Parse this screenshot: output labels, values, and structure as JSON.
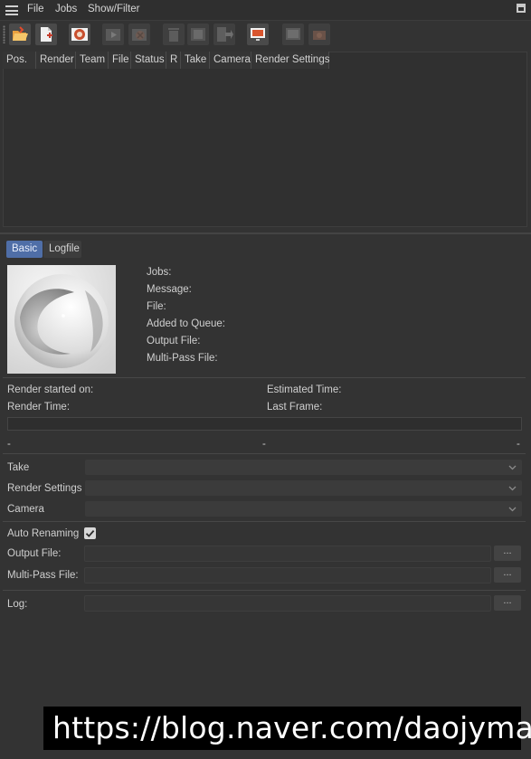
{
  "menu": {
    "items": [
      "File",
      "Jobs",
      "Show/Filter"
    ]
  },
  "toolbar": {
    "buttons": [
      {
        "icon": "open-folder-icon",
        "enabled": true
      },
      {
        "icon": "add-file-icon",
        "enabled": true
      },
      {
        "icon": "render-queue-icon",
        "enabled": true
      },
      {
        "icon": "start-render-icon",
        "enabled": false
      },
      {
        "icon": "stop-render-icon",
        "enabled": false
      },
      {
        "icon": "delete-icon",
        "enabled": false
      },
      {
        "icon": "film-strip-icon",
        "enabled": false
      },
      {
        "icon": "export-icon",
        "enabled": false
      },
      {
        "icon": "monitor-icon",
        "enabled": true
      },
      {
        "icon": "picture-viewer-icon",
        "enabled": false
      },
      {
        "icon": "render-camera-icon",
        "enabled": false
      }
    ]
  },
  "table": {
    "columns": [
      "Pos.",
      "Render",
      "Team",
      "File",
      "Status",
      "R",
      "Take",
      "Camera",
      "Render Settings"
    ],
    "rows": []
  },
  "tabs": {
    "basic": "Basic",
    "logfile": "Logfile",
    "active": "Basic"
  },
  "info": {
    "jobs": "Jobs:",
    "message": "Message:",
    "file": "File:",
    "added": "Added to Queue:",
    "output": "Output File:",
    "multipass": "Multi-Pass File:"
  },
  "times": {
    "started": "Render started on:",
    "estimated": "Estimated Time:",
    "render_time": "Render Time:",
    "last_frame": "Last Frame:"
  },
  "progress": {
    "value": 0,
    "left": "-",
    "mid": "-",
    "right": "-"
  },
  "settings": {
    "take_label": "Take",
    "take_value": "",
    "render_settings_label": "Render Settings",
    "render_settings_value": "",
    "camera_label": "Camera",
    "camera_value": ""
  },
  "output": {
    "auto_renaming_label": "Auto Renaming",
    "auto_renaming_checked": true,
    "output_file_label": "Output File:",
    "output_file_value": "",
    "multipass_file_label": "Multi-Pass File:",
    "multipass_file_value": "",
    "log_label": "Log:",
    "log_value": "",
    "browse_label": "..."
  },
  "watermark": "https://blog.naver.com/daojyman",
  "colors": {
    "accent": "#4f6ea7",
    "background": "#333333",
    "panel": "#303030"
  }
}
